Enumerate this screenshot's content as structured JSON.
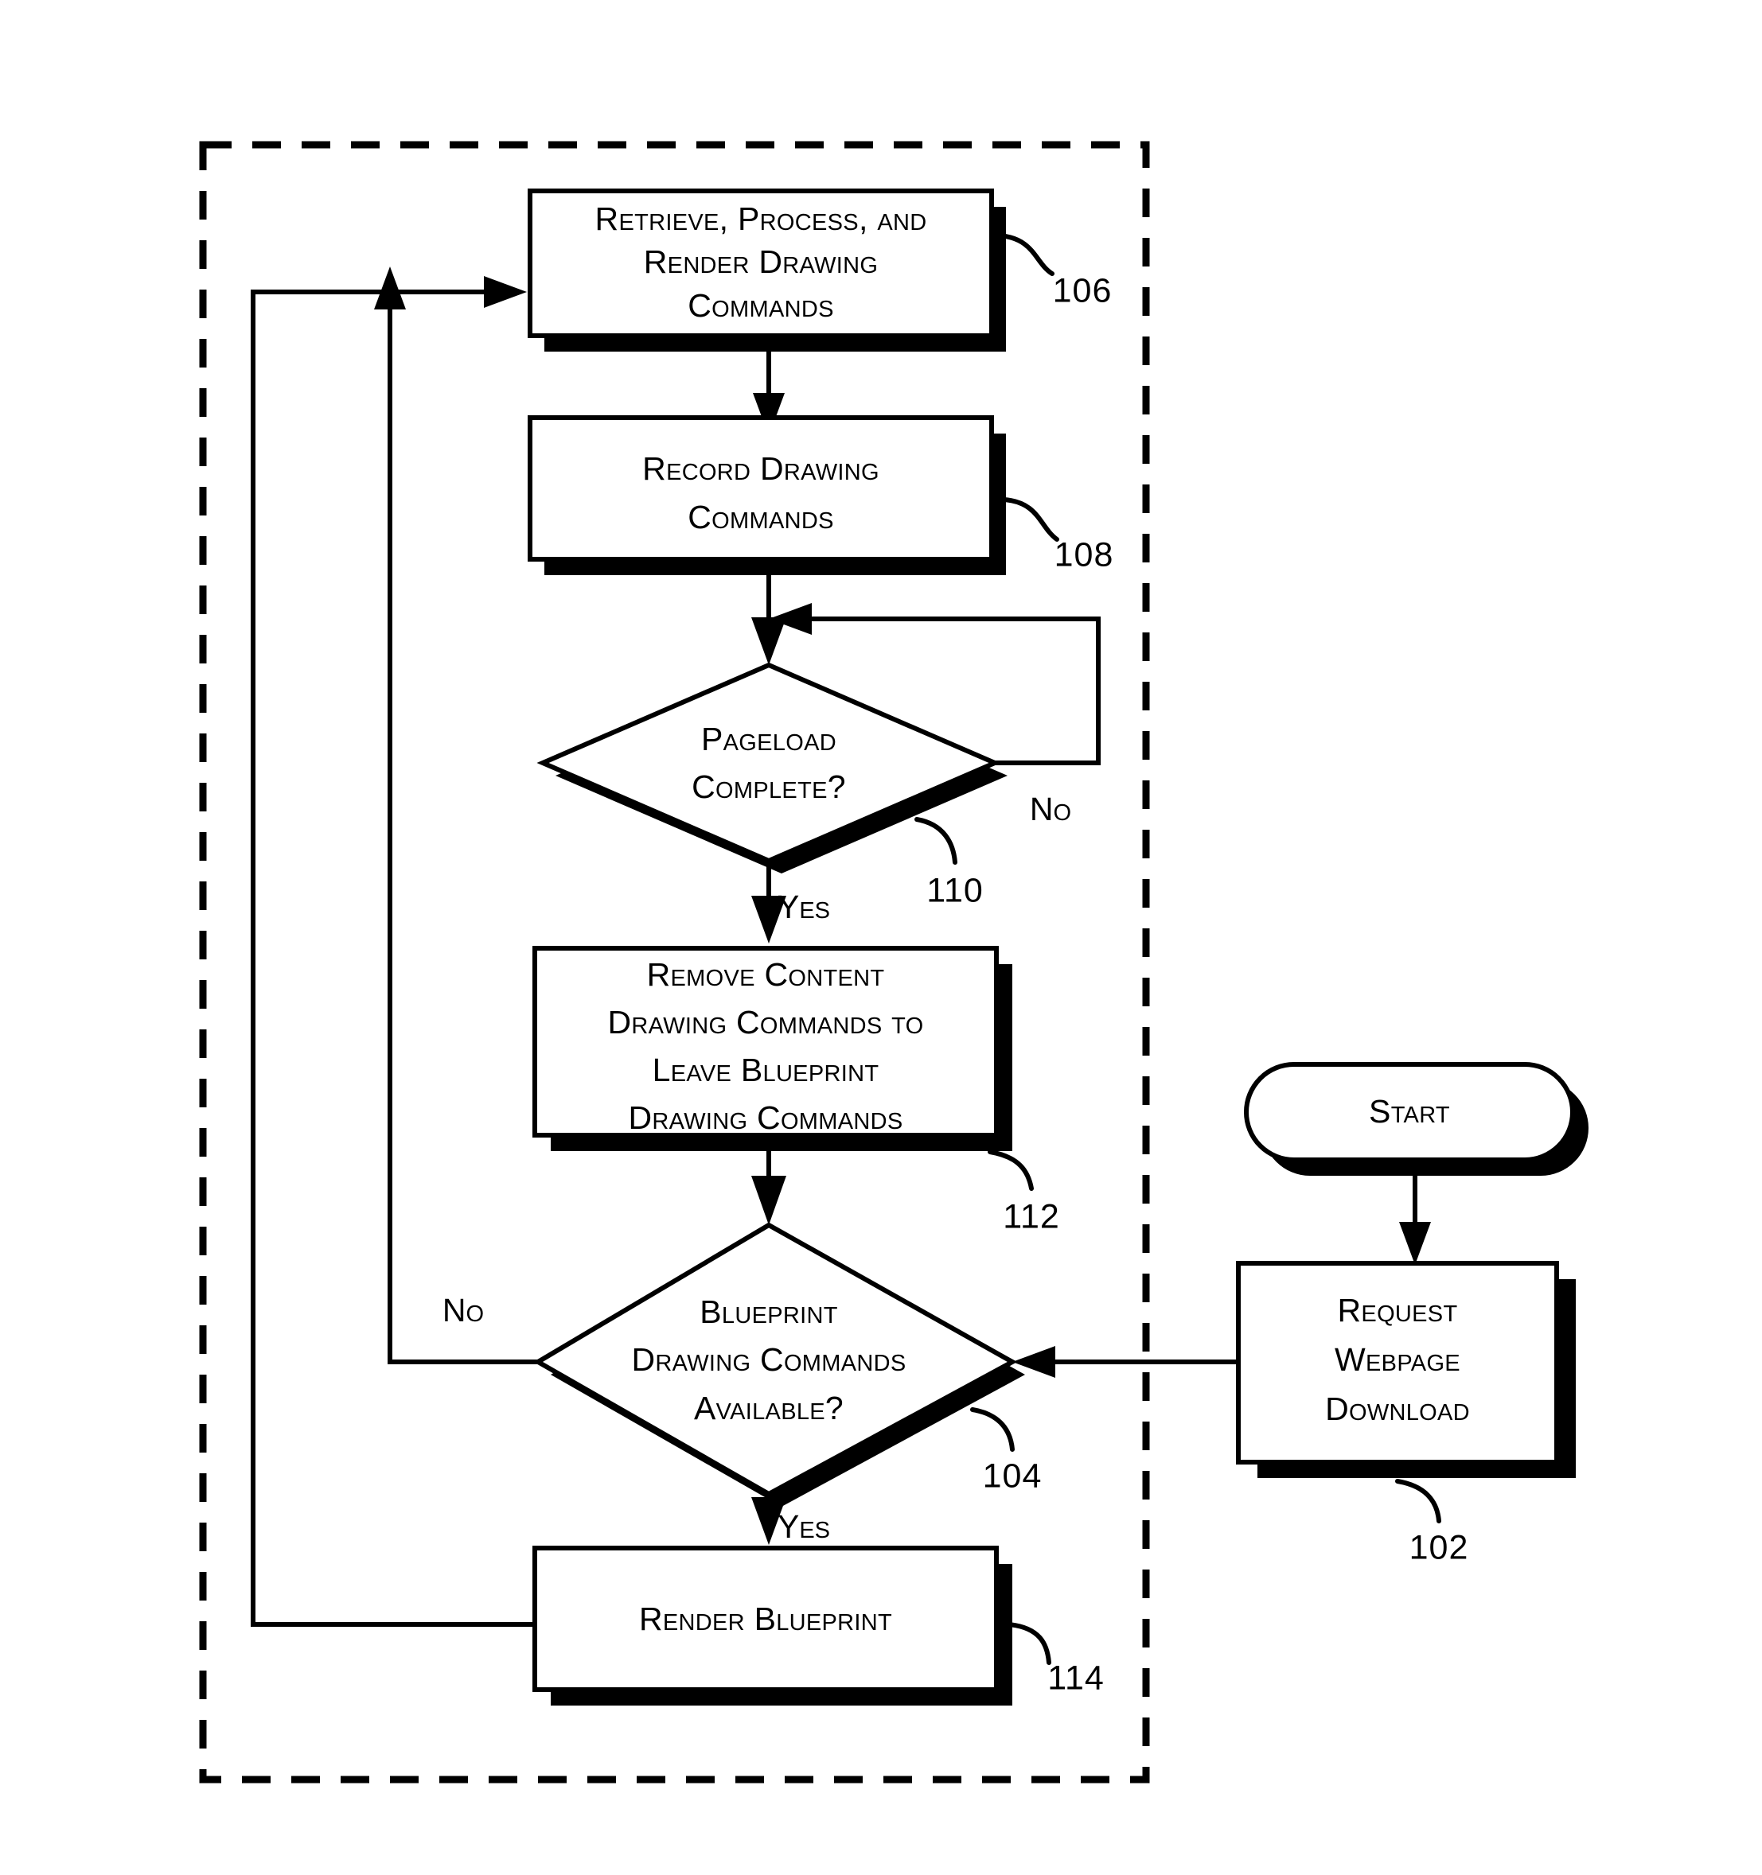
{
  "figure": {
    "type": "patent-flowchart",
    "title": "Webpage Blueprint Rendering Flowchart",
    "background_color": "#ffffff",
    "line_color": "#000000"
  },
  "boundary": {
    "name": "dashed-process-boundary",
    "style": "dashed"
  },
  "nodes": [
    {
      "id": "start",
      "shape": "terminator",
      "label": "Start",
      "lines": [
        "Start"
      ],
      "ref": ""
    },
    {
      "id": "request",
      "shape": "process",
      "label": "Request Webpage Download",
      "lines": [
        "Request",
        "Webpage",
        "Download"
      ],
      "ref": "102"
    },
    {
      "id": "blueprint_available",
      "shape": "decision",
      "label": "Blueprint Drawing Commands Available?",
      "lines": [
        "Blueprint",
        "Drawing Commands",
        "Available?"
      ],
      "ref": "104"
    },
    {
      "id": "retrieve",
      "shape": "process",
      "label": "Retrieve, Process, and Render Drawing Commands",
      "lines": [
        "Retrieve, Process, and",
        "Render Drawing",
        "Commands"
      ],
      "ref": "106"
    },
    {
      "id": "record",
      "shape": "process",
      "label": "Record Drawing Commands",
      "lines": [
        "Record Drawing",
        "Commands"
      ],
      "ref": "108"
    },
    {
      "id": "pageload",
      "shape": "decision",
      "label": "Pageload Complete?",
      "lines": [
        "Pageload",
        "Complete?"
      ],
      "ref": "110"
    },
    {
      "id": "remove",
      "shape": "process",
      "label": "Remove Content Drawing Commands to Leave Blueprint Drawing Commands",
      "lines": [
        "Remove Content",
        "Drawing Commands to",
        "Leave Blueprint",
        "Drawing Commands"
      ],
      "ref": "112"
    },
    {
      "id": "render_blueprint",
      "shape": "process",
      "label": "Render Blueprint",
      "lines": [
        "Render Blueprint"
      ],
      "ref": "114"
    }
  ],
  "branch_labels": {
    "pageload_no": "No",
    "pageload_yes": "Yes",
    "blueprint_no": "No",
    "blueprint_yes": "Yes"
  },
  "refs": {
    "start": "",
    "request": "102",
    "blueprint_available": "104",
    "retrieve": "106",
    "record": "108",
    "pageload": "110",
    "remove": "112",
    "render_blueprint": "114"
  }
}
